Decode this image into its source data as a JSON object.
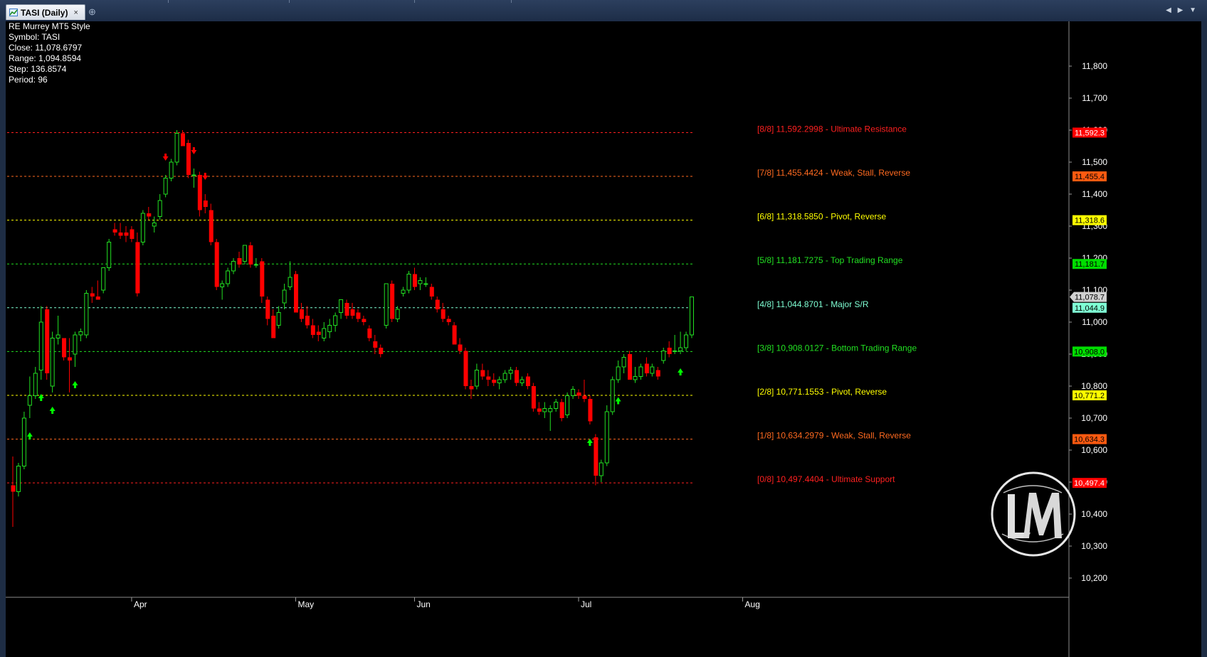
{
  "window": {
    "tab_title": "TASI (Daily)",
    "close_glyph": "×",
    "new_tab_glyph": "⊕",
    "nav_left_glyph": "◀",
    "nav_right_glyph": "▶",
    "nav_down_glyph": "▼"
  },
  "info_panel": {
    "indicator": "RE Murrey MT5 Style",
    "symbol": "Symbol: TASI",
    "close": "Close: 11,078.6797",
    "range": "Range: 1,094.8594",
    "step": "Step: 136.8574",
    "period": "Period: 96"
  },
  "colors": {
    "bull": "#22e022",
    "bear": "#ff0000",
    "background": "#000000",
    "axis_text": "#ffffff"
  },
  "chart_data": {
    "type": "candlestick",
    "symbol": "TASI",
    "timeframe": "Daily",
    "ylim": [
      10140,
      11940
    ],
    "y_ticks": [
      10200,
      10300,
      10400,
      10500,
      10600,
      10700,
      10800,
      10900,
      11000,
      11100,
      11200,
      11300,
      11400,
      11500,
      11600,
      11700,
      11800
    ],
    "x_month_labels": [
      {
        "label": "Apr",
        "index": 21
      },
      {
        "label": "May",
        "index": 50
      },
      {
        "label": "Jun",
        "index": 71
      },
      {
        "label": "Jul",
        "index": 100
      },
      {
        "label": "Aug",
        "index": 129
      }
    ],
    "murrey_levels": [
      {
        "tag": "[8/8]",
        "value": 11592.2998,
        "label": "[8/8] 11,592.2998 - Ultimate Resistance",
        "axis_label": "11,592.3",
        "color": "#ff2020",
        "axis_bg": "#ff0000",
        "axis_fg": "#ffffff"
      },
      {
        "tag": "[7/8]",
        "value": 11455.4424,
        "label": "[7/8] 11,455.4424 - Weak, Stall, Reverse",
        "axis_label": "11,455.4",
        "color": "#ff6a20",
        "axis_bg": "#ff5a10",
        "axis_fg": "#000000"
      },
      {
        "tag": "[6/8]",
        "value": 11318.585,
        "label": "[6/8] 11,318.5850 - Pivot, Reverse",
        "axis_label": "11,318.6",
        "color": "#ffff00",
        "axis_bg": "#ffff00",
        "axis_fg": "#000000"
      },
      {
        "tag": "[5/8]",
        "value": 11181.7275,
        "label": "[5/8] 11,181.7275 - Top Trading Range",
        "axis_label": "11,181.7",
        "color": "#22e022",
        "axis_bg": "#00dd00",
        "axis_fg": "#000000"
      },
      {
        "tag": "[4/8]",
        "value": 11044.8701,
        "label": "[4/8] 11,044.8701 - Major S/R",
        "axis_label": "11,044.9",
        "color": "#7fffd4",
        "axis_bg": "#7fffd4",
        "axis_fg": "#000000"
      },
      {
        "tag": "[3/8]",
        "value": 10908.0127,
        "label": "[3/8] 10,908.0127 - Bottom Trading Range",
        "axis_label": "10,908.0",
        "color": "#22e022",
        "axis_bg": "#00dd00",
        "axis_fg": "#000000"
      },
      {
        "tag": "[2/8]",
        "value": 10771.1553,
        "label": "[2/8] 10,771.1553 - Pivot, Reverse",
        "axis_label": "10,771.2",
        "color": "#ffff00",
        "axis_bg": "#ffff00",
        "axis_fg": "#000000"
      },
      {
        "tag": "[1/8]",
        "value": 10634.2979,
        "label": "[1/8] 10,634.2979 - Weak, Stall, Reverse",
        "axis_label": "10,634.3",
        "color": "#ff6a20",
        "axis_bg": "#ff5a10",
        "axis_fg": "#000000"
      },
      {
        "tag": "[0/8]",
        "value": 10497.4404,
        "label": "[0/8] 10,497.4404 - Ultimate Support",
        "axis_label": "10,497.4",
        "color": "#ff2020",
        "axis_bg": "#ff0000",
        "axis_fg": "#ffffff"
      }
    ],
    "last_price": {
      "value": 11078.6797,
      "axis_label": "11,078.7"
    },
    "candles": [
      {
        "o": 10490,
        "h": 10580,
        "l": 10360,
        "c": 10470
      },
      {
        "o": 10470,
        "h": 10560,
        "l": 10455,
        "c": 10550
      },
      {
        "o": 10550,
        "h": 10720,
        "l": 10540,
        "c": 10700
      },
      {
        "o": 10740,
        "h": 10830,
        "l": 10700,
        "c": 10770
      },
      {
        "o": 10770,
        "h": 10860,
        "l": 10760,
        "c": 10840
      },
      {
        "o": 10850,
        "h": 11050,
        "l": 10820,
        "c": 11000
      },
      {
        "o": 11040,
        "h": 11050,
        "l": 10820,
        "c": 10840
      },
      {
        "o": 10800,
        "h": 10970,
        "l": 10780,
        "c": 10950
      },
      {
        "o": 10950,
        "h": 11020,
        "l": 10930,
        "c": 10960
      },
      {
        "o": 10950,
        "h": 10950,
        "l": 10880,
        "c": 10890
      },
      {
        "o": 10890,
        "h": 10950,
        "l": 10780,
        "c": 10880
      },
      {
        "o": 10900,
        "h": 10970,
        "l": 10860,
        "c": 10960
      },
      {
        "o": 10960,
        "h": 10980,
        "l": 10940,
        "c": 10970
      },
      {
        "o": 10960,
        "h": 11100,
        "l": 10950,
        "c": 11090
      },
      {
        "o": 11090,
        "h": 11110,
        "l": 11060,
        "c": 11080
      },
      {
        "o": 11080,
        "h": 11130,
        "l": 11070,
        "c": 11070
      },
      {
        "o": 11100,
        "h": 11170,
        "l": 11090,
        "c": 11170
      },
      {
        "o": 11170,
        "h": 11260,
        "l": 11160,
        "c": 11250
      },
      {
        "o": 11290,
        "h": 11310,
        "l": 11270,
        "c": 11280
      },
      {
        "o": 11280,
        "h": 11310,
        "l": 11260,
        "c": 11270
      },
      {
        "o": 11280,
        "h": 11300,
        "l": 11250,
        "c": 11270
      },
      {
        "o": 11290,
        "h": 11300,
        "l": 11250,
        "c": 11260
      },
      {
        "o": 11250,
        "h": 11280,
        "l": 11080,
        "c": 11090
      },
      {
        "o": 11250,
        "h": 11350,
        "l": 11240,
        "c": 11340
      },
      {
        "o": 11340,
        "h": 11360,
        "l": 11320,
        "c": 11330
      },
      {
        "o": 11300,
        "h": 11330,
        "l": 11280,
        "c": 11310
      },
      {
        "o": 11330,
        "h": 11400,
        "l": 11320,
        "c": 11380
      },
      {
        "o": 11400,
        "h": 11460,
        "l": 11390,
        "c": 11450
      },
      {
        "o": 11450,
        "h": 11510,
        "l": 11440,
        "c": 11500
      },
      {
        "o": 11500,
        "h": 11600,
        "l": 11490,
        "c": 11590
      },
      {
        "o": 11590,
        "h": 11600,
        "l": 11550,
        "c": 11550
      },
      {
        "o": 11560,
        "h": 11570,
        "l": 11450,
        "c": 11460
      },
      {
        "o": 11460,
        "h": 11480,
        "l": 11420,
        "c": 11460
      },
      {
        "o": 11460,
        "h": 11470,
        "l": 11330,
        "c": 11350
      },
      {
        "o": 11380,
        "h": 11400,
        "l": 11340,
        "c": 11360
      },
      {
        "o": 11350,
        "h": 11370,
        "l": 11240,
        "c": 11250
      },
      {
        "o": 11250,
        "h": 11260,
        "l": 11100,
        "c": 11110
      },
      {
        "o": 11110,
        "h": 11130,
        "l": 11070,
        "c": 11120
      },
      {
        "o": 11120,
        "h": 11170,
        "l": 11110,
        "c": 11160
      },
      {
        "o": 11160,
        "h": 11200,
        "l": 11150,
        "c": 11190
      },
      {
        "o": 11200,
        "h": 11220,
        "l": 11170,
        "c": 11180
      },
      {
        "o": 11190,
        "h": 11240,
        "l": 11180,
        "c": 11240
      },
      {
        "o": 11240,
        "h": 11250,
        "l": 11170,
        "c": 11180
      },
      {
        "o": 11180,
        "h": 11200,
        "l": 11170,
        "c": 11180
      },
      {
        "o": 11190,
        "h": 11200,
        "l": 11060,
        "c": 11080
      },
      {
        "o": 11070,
        "h": 11080,
        "l": 10990,
        "c": 11010
      },
      {
        "o": 11020,
        "h": 11040,
        "l": 10950,
        "c": 10950
      },
      {
        "o": 10990,
        "h": 11050,
        "l": 10980,
        "c": 11030
      },
      {
        "o": 11060,
        "h": 11120,
        "l": 11040,
        "c": 11100
      },
      {
        "o": 11110,
        "h": 11190,
        "l": 11100,
        "c": 11140
      },
      {
        "o": 11150,
        "h": 11160,
        "l": 11030,
        "c": 11030
      },
      {
        "o": 11040,
        "h": 11060,
        "l": 11000,
        "c": 11010
      },
      {
        "o": 11020,
        "h": 11050,
        "l": 10980,
        "c": 10990
      },
      {
        "o": 10990,
        "h": 11010,
        "l": 10950,
        "c": 10960
      },
      {
        "o": 10970,
        "h": 10990,
        "l": 10940,
        "c": 10960
      },
      {
        "o": 10950,
        "h": 11000,
        "l": 10940,
        "c": 10980
      },
      {
        "o": 10970,
        "h": 11010,
        "l": 10950,
        "c": 10990
      },
      {
        "o": 10990,
        "h": 11030,
        "l": 10970,
        "c": 11020
      },
      {
        "o": 11030,
        "h": 11070,
        "l": 11010,
        "c": 11070
      },
      {
        "o": 11060,
        "h": 11070,
        "l": 11010,
        "c": 11020
      },
      {
        "o": 11040,
        "h": 11060,
        "l": 11010,
        "c": 11020
      },
      {
        "o": 11030,
        "h": 11040,
        "l": 11000,
        "c": 11010
      },
      {
        "o": 11010,
        "h": 11020,
        "l": 10990,
        "c": 11000
      },
      {
        "o": 10980,
        "h": 10990,
        "l": 10940,
        "c": 10950
      },
      {
        "o": 10940,
        "h": 10960,
        "l": 10900,
        "c": 10920
      },
      {
        "o": 10920,
        "h": 10930,
        "l": 10890,
        "c": 10900
      },
      {
        "o": 10990,
        "h": 11120,
        "l": 10980,
        "c": 11120
      },
      {
        "o": 11120,
        "h": 11130,
        "l": 11000,
        "c": 11010
      },
      {
        "o": 11010,
        "h": 11050,
        "l": 11000,
        "c": 11040
      },
      {
        "o": 11090,
        "h": 11110,
        "l": 11080,
        "c": 11100
      },
      {
        "o": 11100,
        "h": 11160,
        "l": 11090,
        "c": 11150
      },
      {
        "o": 11150,
        "h": 11170,
        "l": 11100,
        "c": 11110
      },
      {
        "o": 11120,
        "h": 11140,
        "l": 11100,
        "c": 11130
      },
      {
        "o": 11120,
        "h": 11140,
        "l": 11110,
        "c": 11120
      },
      {
        "o": 11110,
        "h": 11120,
        "l": 11070,
        "c": 11080
      },
      {
        "o": 11070,
        "h": 11080,
        "l": 11030,
        "c": 11040
      },
      {
        "o": 11040,
        "h": 11060,
        "l": 11000,
        "c": 11010
      },
      {
        "o": 11010,
        "h": 11020,
        "l": 10990,
        "c": 11000
      },
      {
        "o": 10990,
        "h": 11000,
        "l": 10930,
        "c": 10930
      },
      {
        "o": 10930,
        "h": 10950,
        "l": 10900,
        "c": 10910
      },
      {
        "o": 10910,
        "h": 10920,
        "l": 10790,
        "c": 10800
      },
      {
        "o": 10800,
        "h": 10820,
        "l": 10760,
        "c": 10790
      },
      {
        "o": 10800,
        "h": 10870,
        "l": 10790,
        "c": 10850
      },
      {
        "o": 10850,
        "h": 10870,
        "l": 10820,
        "c": 10830
      },
      {
        "o": 10830,
        "h": 10850,
        "l": 10800,
        "c": 10820
      },
      {
        "o": 10820,
        "h": 10840,
        "l": 10800,
        "c": 10810
      },
      {
        "o": 10810,
        "h": 10830,
        "l": 10790,
        "c": 10820
      },
      {
        "o": 10820,
        "h": 10850,
        "l": 10810,
        "c": 10840
      },
      {
        "o": 10840,
        "h": 10860,
        "l": 10820,
        "c": 10850
      },
      {
        "o": 10850,
        "h": 10860,
        "l": 10800,
        "c": 10810
      },
      {
        "o": 10810,
        "h": 10830,
        "l": 10800,
        "c": 10820
      },
      {
        "o": 10830,
        "h": 10840,
        "l": 10790,
        "c": 10800
      },
      {
        "o": 10800,
        "h": 10810,
        "l": 10720,
        "c": 10730
      },
      {
        "o": 10730,
        "h": 10750,
        "l": 10710,
        "c": 10720
      },
      {
        "o": 10720,
        "h": 10750,
        "l": 10700,
        "c": 10730
      },
      {
        "o": 10720,
        "h": 10740,
        "l": 10660,
        "c": 10730
      },
      {
        "o": 10730,
        "h": 10760,
        "l": 10720,
        "c": 10750
      },
      {
        "o": 10750,
        "h": 10760,
        "l": 10690,
        "c": 10700
      },
      {
        "o": 10710,
        "h": 10780,
        "l": 10700,
        "c": 10770
      },
      {
        "o": 10770,
        "h": 10800,
        "l": 10760,
        "c": 10790
      },
      {
        "o": 10780,
        "h": 10790,
        "l": 10760,
        "c": 10770
      },
      {
        "o": 10770,
        "h": 10820,
        "l": 10750,
        "c": 10760
      },
      {
        "o": 10760,
        "h": 10770,
        "l": 10680,
        "c": 10690
      },
      {
        "o": 10640,
        "h": 10650,
        "l": 10490,
        "c": 10520
      },
      {
        "o": 10520,
        "h": 10570,
        "l": 10500,
        "c": 10560
      },
      {
        "o": 10560,
        "h": 10740,
        "l": 10550,
        "c": 10720
      },
      {
        "o": 10720,
        "h": 10830,
        "l": 10710,
        "c": 10820
      },
      {
        "o": 10820,
        "h": 10880,
        "l": 10810,
        "c": 10860
      },
      {
        "o": 10860,
        "h": 10900,
        "l": 10840,
        "c": 10890
      },
      {
        "o": 10900,
        "h": 10910,
        "l": 10820,
        "c": 10820
      },
      {
        "o": 10820,
        "h": 10860,
        "l": 10810,
        "c": 10830
      },
      {
        "o": 10830,
        "h": 10870,
        "l": 10820,
        "c": 10860
      },
      {
        "o": 10870,
        "h": 10890,
        "l": 10830,
        "c": 10840
      },
      {
        "o": 10840,
        "h": 10870,
        "l": 10830,
        "c": 10860
      },
      {
        "o": 10850,
        "h": 10860,
        "l": 10820,
        "c": 10830
      },
      {
        "o": 10880,
        "h": 10920,
        "l": 10870,
        "c": 10910
      },
      {
        "o": 10920,
        "h": 10940,
        "l": 10890,
        "c": 10900
      },
      {
        "o": 10910,
        "h": 10960,
        "l": 10900,
        "c": 10910
      },
      {
        "o": 10910,
        "h": 10970,
        "l": 10900,
        "c": 10920
      },
      {
        "o": 10920,
        "h": 10970,
        "l": 10910,
        "c": 10960
      },
      {
        "o": 10960,
        "h": 11080,
        "l": 10950,
        "c": 11078.68
      }
    ],
    "signals": [
      {
        "index": 3,
        "dir": "up"
      },
      {
        "index": 5,
        "dir": "up"
      },
      {
        "index": 7,
        "dir": "up"
      },
      {
        "index": 11,
        "dir": "up"
      },
      {
        "index": 27,
        "dir": "down"
      },
      {
        "index": 32,
        "dir": "down"
      },
      {
        "index": 34,
        "dir": "down"
      },
      {
        "index": 102,
        "dir": "up"
      },
      {
        "index": 107,
        "dir": "up"
      },
      {
        "index": 118,
        "dir": "up"
      }
    ]
  }
}
